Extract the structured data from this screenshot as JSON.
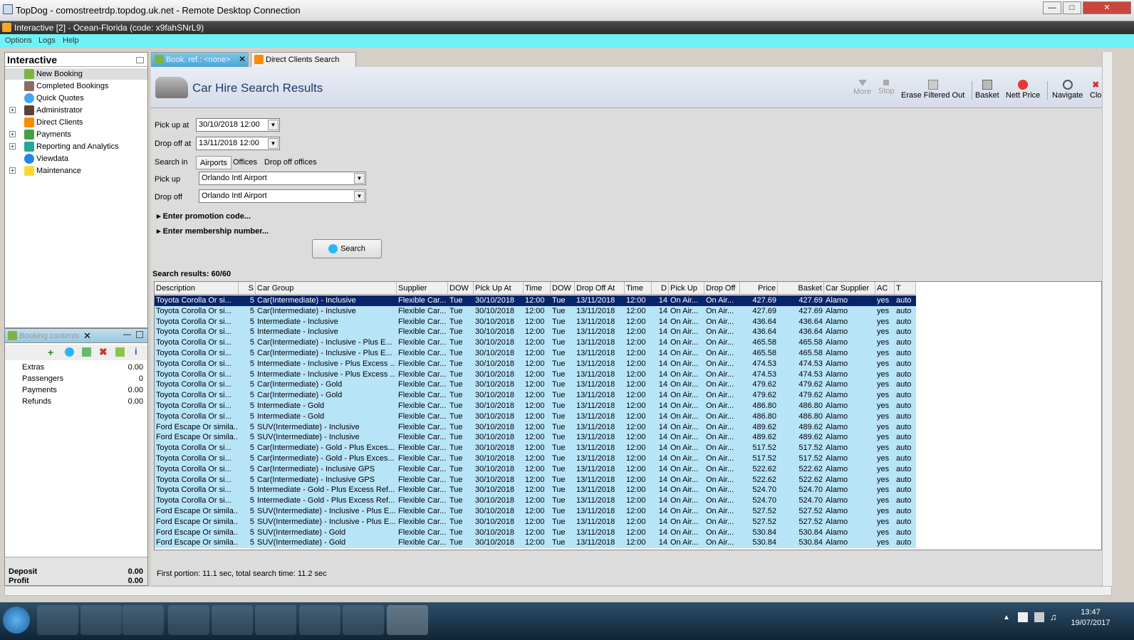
{
  "rdp": {
    "title": "TopDog - comostreetrdp.topdog.uk.net - Remote Desktop Connection"
  },
  "app": {
    "title": "Interactive [2] - Ocean-Florida (code: x9fahSNrL9)"
  },
  "menu": {
    "options": "Options",
    "logs": "Logs",
    "help": "Help"
  },
  "sidebar": {
    "title": "Interactive",
    "items": [
      {
        "label": "New Booking"
      },
      {
        "label": "Completed Bookings"
      },
      {
        "label": "Quick Quotes"
      },
      {
        "label": "Administrator"
      },
      {
        "label": "Direct Clients"
      },
      {
        "label": "Payments"
      },
      {
        "label": "Reporting and Analytics"
      },
      {
        "label": "Viewdata"
      },
      {
        "label": "Maintenance"
      }
    ]
  },
  "booking": {
    "title": "Booking contents",
    "rows": [
      {
        "label": "Extras",
        "value": "0.00"
      },
      {
        "label": "Passengers",
        "value": "0"
      },
      {
        "label": "Payments",
        "value": "0.00"
      },
      {
        "label": "Refunds",
        "value": "0.00"
      }
    ],
    "deposit_label": "Deposit",
    "deposit_value": "0.00",
    "profit_label": "Profit",
    "profit_value": "0.00"
  },
  "tabs": [
    {
      "label": "Book. ref.: <none>"
    },
    {
      "label": "Direct Clients Search"
    }
  ],
  "header": {
    "title": "Car Hire Search Results"
  },
  "toolbar": {
    "more": "More",
    "stop": "Stop",
    "erase": "Erase Filtered Out",
    "basket": "Basket",
    "nett": "Nett Price",
    "navigate": "Navigate",
    "close": "Clo"
  },
  "form": {
    "pickup_at_label": "Pick up at",
    "pickup_at": "30/10/2018 12:00",
    "dropoff_at_label": "Drop off at",
    "dropoff_at": "13/11/2018 12:00",
    "search_in_label": "Search in",
    "search_in_options": [
      "Airports",
      "Offices",
      "Drop off offices"
    ],
    "pickup_label": "Pick up",
    "pickup": "Orlando Intl Airport",
    "dropoff_label": "Drop off",
    "dropoff": "Orlando Intl Airport",
    "promo": "Enter promotion code...",
    "membership": "Enter membership number...",
    "search_button": "Search"
  },
  "results": {
    "count_label": "Search results: 60/60",
    "columns": [
      "Description",
      "S",
      "Car Group",
      "Supplier",
      "DOW",
      "Pick Up At",
      "Time",
      "DOW",
      "Drop Off At",
      "Time",
      "D",
      "Pick Up",
      "Drop Off",
      "Price",
      "Basket",
      "Car Supplier",
      "AC",
      "T"
    ],
    "rows": [
      [
        "Toyota Corolla Or si...",
        "5",
        "Car(Intermediate) - Inclusive",
        "Flexible Car...",
        "Tue",
        "30/10/2018",
        "12:00",
        "Tue",
        "13/11/2018",
        "12:00",
        "14",
        "On Air...",
        "On Air...",
        "427.69",
        "427.69",
        "Alamo",
        "yes",
        "auto"
      ],
      [
        "Toyota Corolla Or si...",
        "5",
        "Car(Intermediate) - Inclusive",
        "Flexible Car...",
        "Tue",
        "30/10/2018",
        "12:00",
        "Tue",
        "13/11/2018",
        "12:00",
        "14",
        "On Air...",
        "On Air...",
        "427.69",
        "427.69",
        "Alamo",
        "yes",
        "auto"
      ],
      [
        "Toyota Corolla Or si...",
        "5",
        "Intermediate - Inclusive",
        "Flexible Car...",
        "Tue",
        "30/10/2018",
        "12:00",
        "Tue",
        "13/11/2018",
        "12:00",
        "14",
        "On Air...",
        "On Air...",
        "436.64",
        "436.64",
        "Alamo",
        "yes",
        "auto"
      ],
      [
        "Toyota Corolla Or si...",
        "5",
        "Intermediate - Inclusive",
        "Flexible Car...",
        "Tue",
        "30/10/2018",
        "12:00",
        "Tue",
        "13/11/2018",
        "12:00",
        "14",
        "On Air...",
        "On Air...",
        "436.64",
        "436.64",
        "Alamo",
        "yes",
        "auto"
      ],
      [
        "Toyota Corolla Or si...",
        "5",
        "Car(Intermediate) - Inclusive - Plus E...",
        "Flexible Car...",
        "Tue",
        "30/10/2018",
        "12:00",
        "Tue",
        "13/11/2018",
        "12:00",
        "14",
        "On Air...",
        "On Air...",
        "465.58",
        "465.58",
        "Alamo",
        "yes",
        "auto"
      ],
      [
        "Toyota Corolla Or si...",
        "5",
        "Car(Intermediate) - Inclusive - Plus E...",
        "Flexible Car...",
        "Tue",
        "30/10/2018",
        "12:00",
        "Tue",
        "13/11/2018",
        "12:00",
        "14",
        "On Air...",
        "On Air...",
        "465.58",
        "465.58",
        "Alamo",
        "yes",
        "auto"
      ],
      [
        "Toyota Corolla Or si...",
        "5",
        "Intermediate - Inclusive - Plus Excess ...",
        "Flexible Car...",
        "Tue",
        "30/10/2018",
        "12:00",
        "Tue",
        "13/11/2018",
        "12:00",
        "14",
        "On Air...",
        "On Air...",
        "474.53",
        "474.53",
        "Alamo",
        "yes",
        "auto"
      ],
      [
        "Toyota Corolla Or si...",
        "5",
        "Intermediate - Inclusive - Plus Excess ...",
        "Flexible Car...",
        "Tue",
        "30/10/2018",
        "12:00",
        "Tue",
        "13/11/2018",
        "12:00",
        "14",
        "On Air...",
        "On Air...",
        "474.53",
        "474.53",
        "Alamo",
        "yes",
        "auto"
      ],
      [
        "Toyota Corolla Or si...",
        "5",
        "Car(Intermediate) - Gold",
        "Flexible Car...",
        "Tue",
        "30/10/2018",
        "12:00",
        "Tue",
        "13/11/2018",
        "12:00",
        "14",
        "On Air...",
        "On Air...",
        "479.62",
        "479.62",
        "Alamo",
        "yes",
        "auto"
      ],
      [
        "Toyota Corolla Or si...",
        "5",
        "Car(Intermediate) - Gold",
        "Flexible Car...",
        "Tue",
        "30/10/2018",
        "12:00",
        "Tue",
        "13/11/2018",
        "12:00",
        "14",
        "On Air...",
        "On Air...",
        "479.62",
        "479.62",
        "Alamo",
        "yes",
        "auto"
      ],
      [
        "Toyota Corolla Or si...",
        "5",
        "Intermediate - Gold",
        "Flexible Car...",
        "Tue",
        "30/10/2018",
        "12:00",
        "Tue",
        "13/11/2018",
        "12:00",
        "14",
        "On Air...",
        "On Air...",
        "486.80",
        "486.80",
        "Alamo",
        "yes",
        "auto"
      ],
      [
        "Toyota Corolla Or si...",
        "5",
        "Intermediate - Gold",
        "Flexible Car...",
        "Tue",
        "30/10/2018",
        "12:00",
        "Tue",
        "13/11/2018",
        "12:00",
        "14",
        "On Air...",
        "On Air...",
        "486.80",
        "486.80",
        "Alamo",
        "yes",
        "auto"
      ],
      [
        "Ford Escape Or simila...",
        "5",
        "SUV(Intermediate) - Inclusive",
        "Flexible Car...",
        "Tue",
        "30/10/2018",
        "12:00",
        "Tue",
        "13/11/2018",
        "12:00",
        "14",
        "On Air...",
        "On Air...",
        "489.62",
        "489.62",
        "Alamo",
        "yes",
        "auto"
      ],
      [
        "Ford Escape Or simila...",
        "5",
        "SUV(Intermediate) - Inclusive",
        "Flexible Car...",
        "Tue",
        "30/10/2018",
        "12:00",
        "Tue",
        "13/11/2018",
        "12:00",
        "14",
        "On Air...",
        "On Air...",
        "489.62",
        "489.62",
        "Alamo",
        "yes",
        "auto"
      ],
      [
        "Toyota Corolla Or si...",
        "5",
        "Car(Intermediate) - Gold - Plus Exces...",
        "Flexible Car...",
        "Tue",
        "30/10/2018",
        "12:00",
        "Tue",
        "13/11/2018",
        "12:00",
        "14",
        "On Air...",
        "On Air...",
        "517.52",
        "517.52",
        "Alamo",
        "yes",
        "auto"
      ],
      [
        "Toyota Corolla Or si...",
        "5",
        "Car(Intermediate) - Gold - Plus Exces...",
        "Flexible Car...",
        "Tue",
        "30/10/2018",
        "12:00",
        "Tue",
        "13/11/2018",
        "12:00",
        "14",
        "On Air...",
        "On Air...",
        "517.52",
        "517.52",
        "Alamo",
        "yes",
        "auto"
      ],
      [
        "Toyota Corolla Or si...",
        "5",
        "Car(Intermediate) - Inclusive GPS",
        "Flexible Car...",
        "Tue",
        "30/10/2018",
        "12:00",
        "Tue",
        "13/11/2018",
        "12:00",
        "14",
        "On Air...",
        "On Air...",
        "522.62",
        "522.62",
        "Alamo",
        "yes",
        "auto"
      ],
      [
        "Toyota Corolla Or si...",
        "5",
        "Car(Intermediate) - Inclusive GPS",
        "Flexible Car...",
        "Tue",
        "30/10/2018",
        "12:00",
        "Tue",
        "13/11/2018",
        "12:00",
        "14",
        "On Air...",
        "On Air...",
        "522.62",
        "522.62",
        "Alamo",
        "yes",
        "auto"
      ],
      [
        "Toyota Corolla Or si...",
        "5",
        "Intermediate - Gold - Plus Excess Ref...",
        "Flexible Car...",
        "Tue",
        "30/10/2018",
        "12:00",
        "Tue",
        "13/11/2018",
        "12:00",
        "14",
        "On Air...",
        "On Air...",
        "524.70",
        "524.70",
        "Alamo",
        "yes",
        "auto"
      ],
      [
        "Toyota Corolla Or si...",
        "5",
        "Intermediate - Gold - Plus Excess Ref...",
        "Flexible Car...",
        "Tue",
        "30/10/2018",
        "12:00",
        "Tue",
        "13/11/2018",
        "12:00",
        "14",
        "On Air...",
        "On Air...",
        "524.70",
        "524.70",
        "Alamo",
        "yes",
        "auto"
      ],
      [
        "Ford Escape Or simila...",
        "5",
        "SUV(Intermediate) - Inclusive - Plus E...",
        "Flexible Car...",
        "Tue",
        "30/10/2018",
        "12:00",
        "Tue",
        "13/11/2018",
        "12:00",
        "14",
        "On Air...",
        "On Air...",
        "527.52",
        "527.52",
        "Alamo",
        "yes",
        "auto"
      ],
      [
        "Ford Escape Or simila...",
        "5",
        "SUV(Intermediate) - Inclusive - Plus E...",
        "Flexible Car...",
        "Tue",
        "30/10/2018",
        "12:00",
        "Tue",
        "13/11/2018",
        "12:00",
        "14",
        "On Air...",
        "On Air...",
        "527.52",
        "527.52",
        "Alamo",
        "yes",
        "auto"
      ],
      [
        "Ford Escape Or simila...",
        "5",
        "SUV(Intermediate) - Gold",
        "Flexible Car...",
        "Tue",
        "30/10/2018",
        "12:00",
        "Tue",
        "13/11/2018",
        "12:00",
        "14",
        "On Air...",
        "On Air...",
        "530.84",
        "530.84",
        "Alamo",
        "yes",
        "auto"
      ],
      [
        "Ford Escape Or simila...",
        "5",
        "SUV(Intermediate) - Gold",
        "Flexible Car...",
        "Tue",
        "30/10/2018",
        "12:00",
        "Tue",
        "13/11/2018",
        "12:00",
        "14",
        "On Air...",
        "On Air...",
        "530.84",
        "530.84",
        "Alamo",
        "yes",
        "auto"
      ]
    ],
    "status": "First portion: 11.1 sec, total search time: 11.2 sec"
  },
  "clock": {
    "time": "13:47",
    "date": "19/07/2017"
  }
}
